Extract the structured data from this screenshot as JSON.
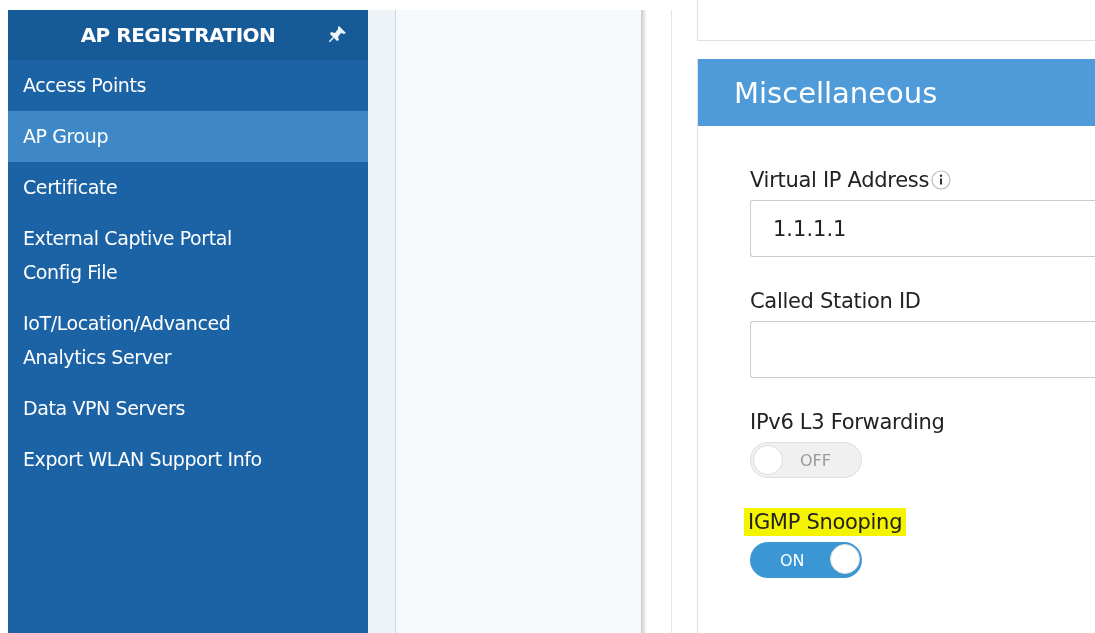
{
  "sidebar": {
    "title": "AP REGISTRATION",
    "pinned": true,
    "items": [
      {
        "label": "Access Points",
        "selected": false
      },
      {
        "label": "AP Group",
        "selected": true
      },
      {
        "label": "Certificate",
        "selected": false
      },
      {
        "label": "External Captive Portal Config File",
        "selected": false
      },
      {
        "label": "IoT/Location/Advanced Analytics Server",
        "selected": false
      },
      {
        "label": "Data VPN Servers",
        "selected": false
      },
      {
        "label": "Export WLAN Support Info",
        "selected": false
      }
    ]
  },
  "section": {
    "title": "Miscellaneous",
    "fields": [
      {
        "kind": "text",
        "label": "Virtual IP Address",
        "info": true,
        "value": "1.1.1.1",
        "highlighted": false
      },
      {
        "kind": "text",
        "label": "Called Station ID",
        "info": false,
        "highlighted": false
      },
      {
        "kind": "toggle",
        "label": "IPv6 L3 Forwarding",
        "on": false,
        "state_text": "OFF",
        "highlighted": false
      },
      {
        "kind": "toggle",
        "label": "IGMP Snooping",
        "on": true,
        "state_text": "ON",
        "highlighted": true
      }
    ]
  }
}
